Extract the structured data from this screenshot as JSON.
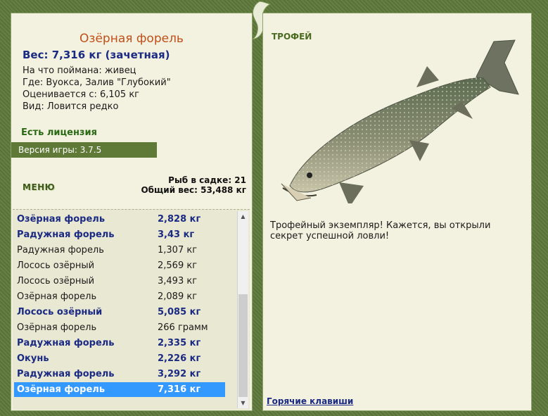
{
  "catch": {
    "fish_name": "Озёрная форель",
    "weight_line": "Вес: 7,316 кг (зачетная)",
    "bait": "На что поймана: живец",
    "location": "Где: Вуокса, Залив \"Глубокий\"",
    "rated_from": "Оценивается с: 6,105 кг",
    "kind": "Вид: Ловится редко"
  },
  "license": "Есть лицензия",
  "version": "Версия игры: 3.7.5",
  "menu_label": "МЕНЮ",
  "net": {
    "fish_count": "Рыб в садке: 21",
    "total_weight": "Общий вес: 53,488 кг"
  },
  "fish_list": [
    {
      "name": "Озёрная форель",
      "weight": "2,828 кг",
      "style": "bold"
    },
    {
      "name": "Радужная форель",
      "weight": "3,43 кг",
      "style": "bold"
    },
    {
      "name": "Радужная форель",
      "weight": "1,307 кг",
      "style": "normal"
    },
    {
      "name": "Лосось озёрный",
      "weight": "2,569 кг",
      "style": "normal"
    },
    {
      "name": "Лосось озёрный",
      "weight": "3,493 кг",
      "style": "normal"
    },
    {
      "name": "Озёрная форель",
      "weight": "2,089 кг",
      "style": "normal"
    },
    {
      "name": "Лосось озёрный",
      "weight": "5,085 кг",
      "style": "bold"
    },
    {
      "name": "Озёрная форель",
      "weight": "266 грамм",
      "style": "normal"
    },
    {
      "name": "Радужная форель",
      "weight": "2,335 кг",
      "style": "bold"
    },
    {
      "name": "Окунь",
      "weight": "2,226 кг",
      "style": "bold"
    },
    {
      "name": "Радужная форель",
      "weight": "3,292 кг",
      "style": "bold"
    },
    {
      "name": "Озёрная форель",
      "weight": "7,316 кг",
      "style": "selected"
    }
  ],
  "trophy": {
    "label": "ТРОФЕЙ",
    "text": "Трофейный экземпляр! Кажется, вы открыли секрет успешной ловли!"
  },
  "hotkeys_link": "Горячие клавиши",
  "icons": {
    "deco": "fish-silhouette-icon",
    "scroll_up": "chevron-up-icon",
    "scroll_down": "chevron-down-icon"
  },
  "colors": {
    "frame": "#5d783a",
    "panel": "#f3f1df",
    "title": "#c0501a",
    "bold_text": "#1b2a83",
    "selection": "#3399ff",
    "license": "#2a6a14"
  }
}
